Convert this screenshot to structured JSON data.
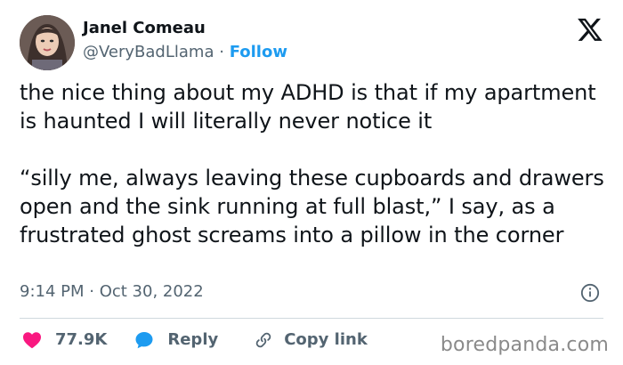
{
  "author": {
    "name": "Janel Comeau",
    "handle": "@VeryBadLlama",
    "separator": "·",
    "follow_label": "Follow"
  },
  "tweet": {
    "text": "the nice thing about my ADHD is that if my apartment is haunted I will literally never notice it\n\n“silly me, always leaving these cupboards and drawers open and the sink running at full blast,” I say, as a frustrated ghost screams into a pillow in the corner",
    "timestamp": "9:14 PM · Oct 30, 2022"
  },
  "actions": {
    "likes": "77.9K",
    "reply_label": "Reply",
    "copy_label": "Copy link"
  },
  "icons": {
    "platform": "x-logo-icon",
    "info": "info-icon",
    "like": "heart-icon",
    "reply": "speech-bubble-icon",
    "copy": "link-icon"
  },
  "colors": {
    "follow": "#1d9bf0",
    "heart": "#f91880",
    "reply_bubble": "#1d9bf0",
    "secondary_text": "#536471"
  },
  "watermark": "boredpanda.com"
}
